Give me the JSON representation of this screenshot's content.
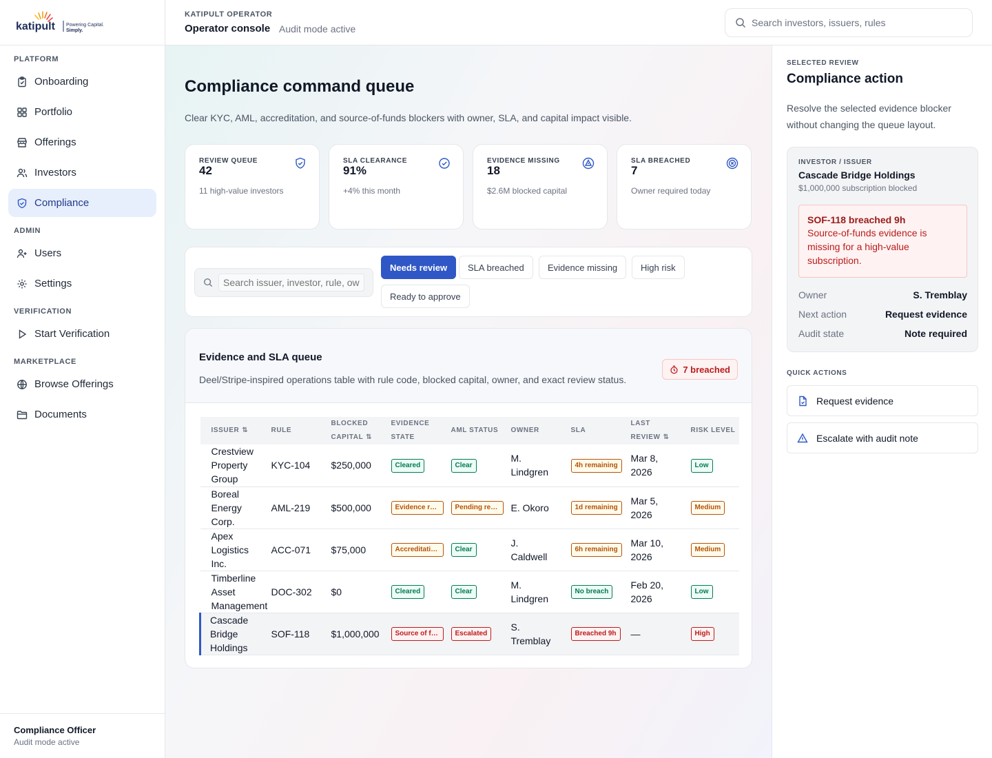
{
  "brand": {
    "logo_text": "katipult",
    "tagline_1": "Powering Capital.",
    "tagline_2": "Simply."
  },
  "sidebar": {
    "sections": [
      {
        "label": "PLATFORM",
        "items": [
          {
            "label": "Onboarding"
          },
          {
            "label": "Portfolio"
          },
          {
            "label": "Offerings"
          },
          {
            "label": "Investors"
          },
          {
            "label": "Compliance"
          }
        ]
      },
      {
        "label": "ADMIN",
        "items": [
          {
            "label": "Users"
          },
          {
            "label": "Settings"
          }
        ]
      },
      {
        "label": "VERIFICATION",
        "items": [
          {
            "label": "Start Verification"
          }
        ]
      },
      {
        "label": "MARKETPLACE",
        "items": [
          {
            "label": "Browse Offerings"
          },
          {
            "label": "Documents"
          }
        ]
      }
    ],
    "footer": {
      "name": "Compliance Officer",
      "status": "Audit mode active"
    }
  },
  "topbar": {
    "eyebrow": "KATIPULT OPERATOR",
    "title": "Operator console",
    "subtitle": "Audit mode active",
    "search_placeholder": "Search investors, issuers, rules"
  },
  "main": {
    "title": "Compliance command queue",
    "description": "Clear KYC, AML, accreditation, and source-of-funds blockers with owner, SLA, and capital impact visible.",
    "stats": [
      {
        "label": "REVIEW QUEUE",
        "value": "42",
        "note": "11 high-value investors",
        "icon": "shield-check-icon"
      },
      {
        "label": "SLA CLEARANCE",
        "value": "91%",
        "note": "+4% this month",
        "icon": "check-badge-icon"
      },
      {
        "label": "EVIDENCE MISSING",
        "value": "18",
        "note": "$2.6M blocked capital",
        "icon": "warning-icon"
      },
      {
        "label": "SLA BREACHED",
        "value": "7",
        "note": "Owner required today",
        "icon": "x-circle-icon"
      }
    ],
    "filters": {
      "search_placeholder": "Search issuer, investor, rule, owner",
      "chips": [
        {
          "label": "Needs review"
        },
        {
          "label": "SLA breached"
        },
        {
          "label": "Evidence missing"
        },
        {
          "label": "High risk"
        },
        {
          "label": "Ready to approve"
        }
      ]
    },
    "queue": {
      "title": "Evidence and SLA queue",
      "description": "Deel/Stripe-inspired operations table with rule code, blocked capital, owner, and exact review status.",
      "badge": "7 breached",
      "columns": {
        "issuer": "ISSUER",
        "rule": "RULE",
        "blocked_capital": "BLOCKED CAPITAL",
        "evidence_state": "EVIDENCE STATE",
        "aml_status": "AML STATUS",
        "owner": "OWNER",
        "sla": "SLA",
        "last_review": "LAST REVIEW",
        "risk_level": "RISK LEVEL"
      },
      "rows": [
        {
          "issuer": "Crestview Property Group",
          "rule": "KYC-104",
          "capital": "$250,000",
          "evidence": "Cleared",
          "aml": "Clear",
          "owner": "M. Lindgren",
          "sla": "4h remaining",
          "last_review": "Mar 8, 2026",
          "risk": "Low"
        },
        {
          "issuer": "Boreal Energy Corp.",
          "rule": "AML-219",
          "capital": "$500,000",
          "evidence": "Evidence requested",
          "aml": "Pending review",
          "owner": "E. Okoro",
          "sla": "1d remaining",
          "last_review": "Mar 5, 2026",
          "risk": "Medium"
        },
        {
          "issuer": "Apex Logistics Inc.",
          "rule": "ACC-071",
          "capital": "$75,000",
          "evidence": "Accreditation pending",
          "aml": "Clear",
          "owner": "J. Caldwell",
          "sla": "6h remaining",
          "last_review": "Mar 10, 2026",
          "risk": "Medium"
        },
        {
          "issuer": "Timberline Asset Management",
          "rule": "DOC-302",
          "capital": "$0",
          "evidence": "Cleared",
          "aml": "Clear",
          "owner": "M. Lindgren",
          "sla": "No breach",
          "last_review": "Feb 20, 2026",
          "risk": "Low"
        },
        {
          "issuer": "Cascade Bridge Holdings",
          "rule": "SOF-118",
          "capital": "$1,000,000",
          "evidence": "Source of funds missing",
          "aml": "Escalated",
          "owner": "S. Tremblay",
          "sla": "Breached 9h",
          "last_review": "—",
          "risk": "High"
        }
      ]
    }
  },
  "panel": {
    "eyebrow": "SELECTED REVIEW",
    "title": "Compliance action",
    "description": "Resolve the selected evidence blocker without changing the queue layout.",
    "card": {
      "eyebrow": "INVESTOR / ISSUER",
      "name": "Cascade Bridge Holdings",
      "subtitle": "$1,000,000 subscription blocked",
      "alert_title": "SOF-118 breached 9h",
      "alert_text": "Source-of-funds evidence is missing for a high-value subscription.",
      "owner_label": "Owner",
      "owner_value": "S. Tremblay",
      "next_label": "Next action",
      "next_value": "Request evidence",
      "audit_label": "Audit state",
      "audit_value": "Note required"
    },
    "quick_actions_label": "QUICK ACTIONS",
    "quick_actions": [
      {
        "label": "Request evidence",
        "icon": "document-icon"
      },
      {
        "label": "Escalate with audit note",
        "icon": "warning-icon"
      }
    ]
  },
  "colors": {
    "accent": "#2f58c6",
    "danger": "#b91c1c",
    "success": "#047857",
    "warning": "#b45309"
  }
}
